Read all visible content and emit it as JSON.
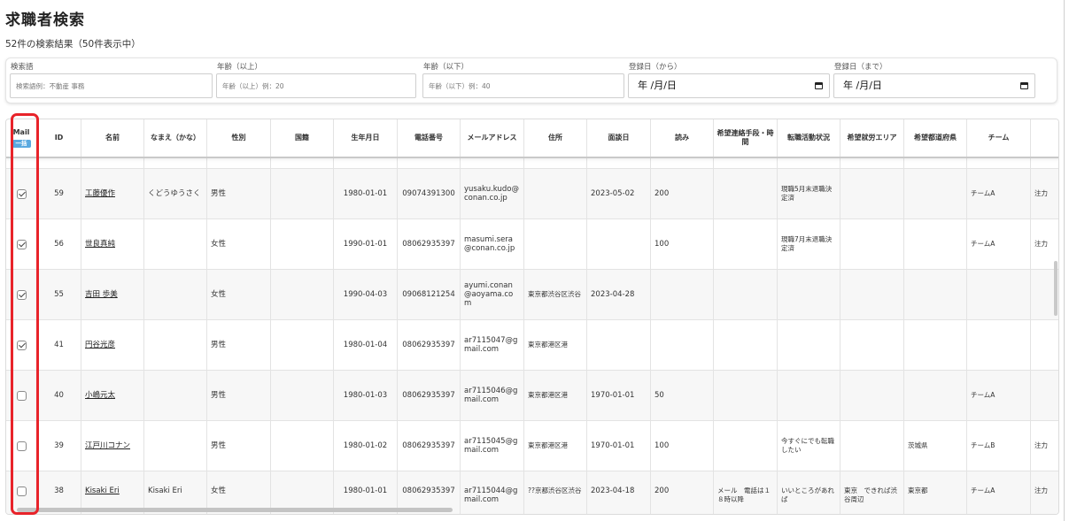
{
  "page": {
    "title": "求職者検索",
    "result_count": "52件の検索結果（50件表示中）"
  },
  "filters": {
    "keyword": {
      "label": "検索語",
      "placeholder": "検索語例：不動産 事務",
      "value": ""
    },
    "age_min": {
      "label": "年齢（以上）",
      "placeholder": "年齢（以上）例：20",
      "value": ""
    },
    "age_max": {
      "label": "年齢（以下）",
      "placeholder": "年齢（以下）例：40",
      "value": ""
    },
    "date_from": {
      "label": "登録日（から）",
      "value": "年 /月/日"
    },
    "date_to": {
      "label": "登録日（まで）",
      "value": "年 /月/日"
    }
  },
  "table": {
    "mail_header": "Mail",
    "mail_badge": "一括",
    "columns": [
      "ID",
      "名前",
      "なまえ（かな）",
      "性別",
      "国籍",
      "生年月日",
      "電話番号",
      "メールアドレス",
      "住所",
      "面談日",
      "読み",
      "希望連絡手段・時間",
      "転職活動状況",
      "希望就労エリア",
      "希望都道府県",
      "チーム",
      ""
    ],
    "rows": [
      {
        "checked": true,
        "id": "59",
        "name": "工藤優作",
        "kana": "くどうゆうさく",
        "gender": "男性",
        "nationality": "",
        "birth": "1980-01-01",
        "phone": "09074391300",
        "email": "yusaku.kudo@conan.co.jp",
        "address": "",
        "interview": "2023-05-02",
        "reading": "200",
        "contact": "",
        "status": "現職5月末退職決定済",
        "area": "",
        "pref": "",
        "team": "チームA",
        "extra": "注力"
      },
      {
        "checked": true,
        "id": "56",
        "name": "世良真純",
        "kana": "",
        "gender": "女性",
        "nationality": "",
        "birth": "1990-01-01",
        "phone": "08062935397",
        "email": "masumi.sera@conan.co.jp",
        "address": "",
        "interview": "",
        "reading": "100",
        "contact": "",
        "status": "現職7月末退職決定済",
        "area": "",
        "pref": "",
        "team": "チームA",
        "extra": "注力"
      },
      {
        "checked": true,
        "id": "55",
        "name": "吉田 歩美",
        "kana": "",
        "gender": "女性",
        "nationality": "",
        "birth": "1990-04-03",
        "phone": "09068121254",
        "email": "ayumi.conan@aoyama.com",
        "address": "東京都渋谷区渋谷",
        "interview": "2023-04-28",
        "reading": "",
        "contact": "",
        "status": "",
        "area": "",
        "pref": "",
        "team": "",
        "extra": ""
      },
      {
        "checked": true,
        "id": "41",
        "name": "円谷光彦",
        "kana": "",
        "gender": "男性",
        "nationality": "",
        "birth": "1980-01-04",
        "phone": "08062935397",
        "email": "ar7115047@gmail.com",
        "address": "東京都港区港",
        "interview": "",
        "reading": "",
        "contact": "",
        "status": "",
        "area": "",
        "pref": "",
        "team": "",
        "extra": ""
      },
      {
        "checked": false,
        "id": "40",
        "name": "小嶋元太",
        "kana": "",
        "gender": "男性",
        "nationality": "",
        "birth": "1980-01-03",
        "phone": "08062935397",
        "email": "ar7115046@gmail.com",
        "address": "東京都港区港",
        "interview": "1970-01-01",
        "reading": "50",
        "contact": "",
        "status": "",
        "area": "",
        "pref": "",
        "team": "チームA",
        "extra": ""
      },
      {
        "checked": false,
        "id": "39",
        "name": "江戸川コナン",
        "kana": "",
        "gender": "男性",
        "nationality": "",
        "birth": "1980-01-02",
        "phone": "08062935397",
        "email": "ar7115045@gmail.com",
        "address": "東京都港区港",
        "interview": "1970-01-01",
        "reading": "100",
        "contact": "",
        "status": "今すぐにでも転職したい",
        "area": "",
        "pref": "茨城県",
        "team": "チームB",
        "extra": "注力"
      },
      {
        "checked": false,
        "id": "38",
        "name": "Kisaki Eri",
        "kana": "Kisaki Eri",
        "gender": "女性",
        "nationality": "",
        "birth": "1980-01-01",
        "phone": "08062935397",
        "email": "ar7115044@gmail.com",
        "address": "??京都渋谷区渋谷",
        "interview": "2023-04-18",
        "reading": "200",
        "contact": "メール　電話は１８時以降",
        "status": "いいところがあれば",
        "area": "東京　できれば渋谷周辺",
        "pref": "東京都",
        "team": "チームA",
        "extra": "注力"
      }
    ]
  }
}
